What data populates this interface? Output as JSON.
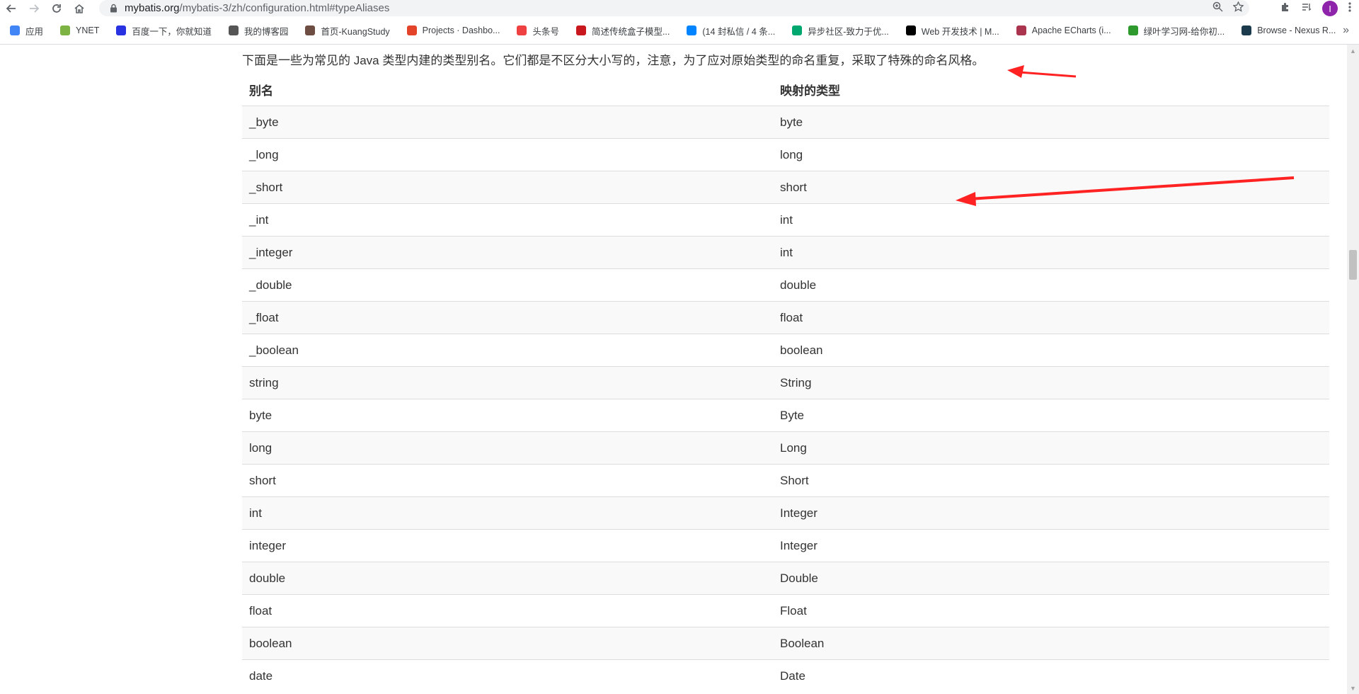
{
  "browser": {
    "url_host": "mybatis.org",
    "url_path": "/mybatis-3/zh/configuration.html#typeAliases",
    "avatar_letter": "I"
  },
  "bookmarks": [
    {
      "label": "应用",
      "icon": "apps-grid-icon",
      "color": "#4285f4"
    },
    {
      "label": "YNET",
      "icon": "ynet-icon",
      "color": "#7cb342"
    },
    {
      "label": "百度一下，你就知道",
      "icon": "baidu-paw-icon",
      "color": "#2932e1"
    },
    {
      "label": "我的博客园",
      "icon": "cnblogs-icon",
      "color": "#555555"
    },
    {
      "label": "首页-KuangStudy",
      "icon": "kuangstudy-icon",
      "color": "#6d4c41"
    },
    {
      "label": "Projects · Dashbo...",
      "icon": "gitlab-icon",
      "color": "#e24329"
    },
    {
      "label": "头条号",
      "icon": "toutiao-icon",
      "color": "#f04142"
    },
    {
      "label": "简述传统盒子模型...",
      "icon": "csdn-icon",
      "color": "#c9171e"
    },
    {
      "label": "(14 封私信 / 4 条...",
      "icon": "zhihu-icon",
      "color": "#0084ff"
    },
    {
      "label": "异步社区-致力于优...",
      "icon": "epubit-icon",
      "color": "#00a870"
    },
    {
      "label": "Web 开发技术 | M...",
      "icon": "mdn-icon",
      "color": "#000000"
    },
    {
      "label": "Apache ECharts (i...",
      "icon": "echarts-icon",
      "color": "#aa344d"
    },
    {
      "label": "绿叶学习网-给你初...",
      "icon": "lvyestudy-icon",
      "color": "#2e9a2e"
    },
    {
      "label": "Browse - Nexus R...",
      "icon": "nexus-icon",
      "color": "#1b3a4b"
    }
  ],
  "intro_text": "下面是一些为常见的 Java 类型内建的类型别名。它们都是不区分大小写的，注意，为了应对原始类型的命名重复，采取了特殊的命名风格。",
  "table": {
    "headers": [
      "别名",
      "映射的类型"
    ],
    "rows": [
      [
        "_byte",
        "byte"
      ],
      [
        "_long",
        "long"
      ],
      [
        "_short",
        "short"
      ],
      [
        "_int",
        "int"
      ],
      [
        "_integer",
        "int"
      ],
      [
        "_double",
        "double"
      ],
      [
        "_float",
        "float"
      ],
      [
        "_boolean",
        "boolean"
      ],
      [
        "string",
        "String"
      ],
      [
        "byte",
        "Byte"
      ],
      [
        "long",
        "Long"
      ],
      [
        "short",
        "Short"
      ],
      [
        "int",
        "Integer"
      ],
      [
        "integer",
        "Integer"
      ],
      [
        "double",
        "Double"
      ],
      [
        "float",
        "Float"
      ],
      [
        "boolean",
        "Boolean"
      ],
      [
        "date",
        "Date"
      ]
    ]
  },
  "annotation_color": "#ff2222"
}
